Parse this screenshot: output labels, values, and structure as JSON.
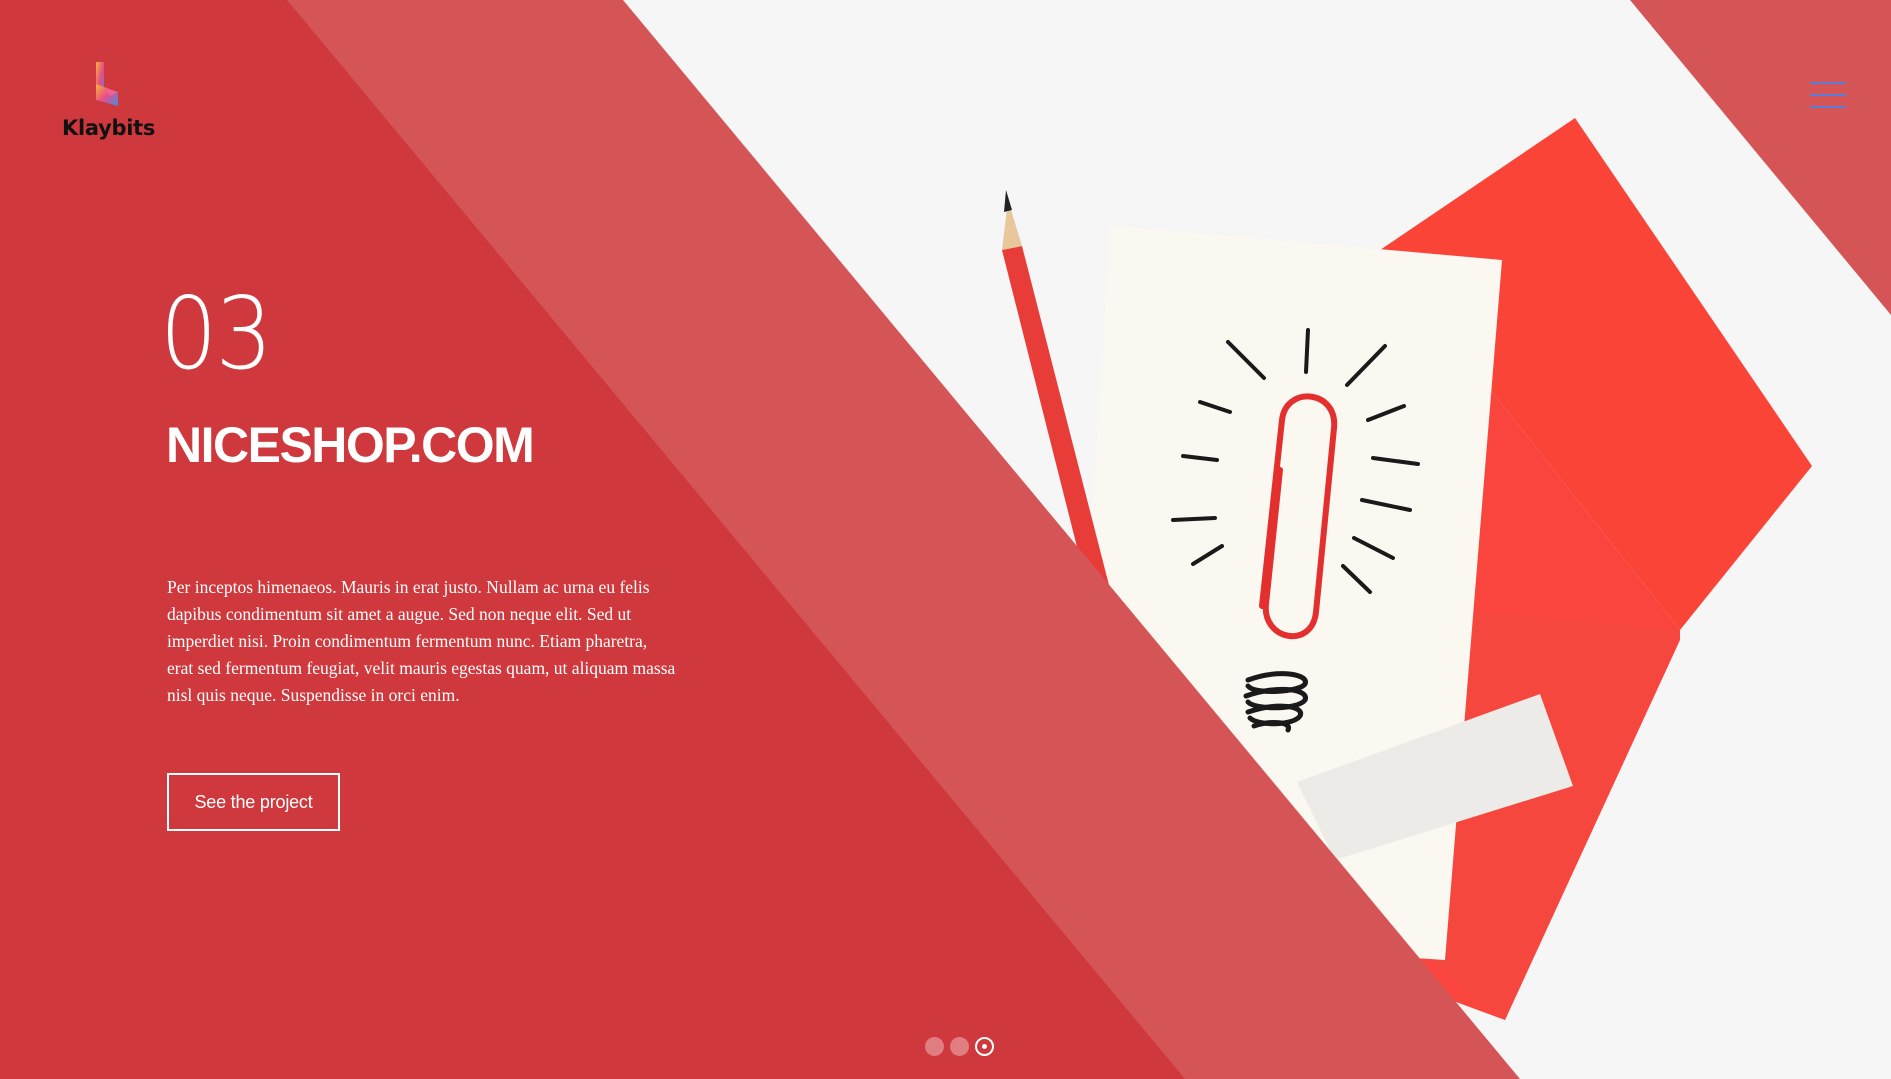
{
  "brand": {
    "name": "Klaybits",
    "logo_icon": "klaybits-logo-mark"
  },
  "header": {
    "menu_icon": "hamburger-menu-icon"
  },
  "slide": {
    "number": "03",
    "title": "NICESHOP.COM",
    "description": "Per inceptos himenaeos. Mauris in erat justo. Nullam ac urna eu felis dapibus condimentum sit amet a augue. Sed non neque elit. Sed ut imperdiet nisi. Proin condimentum fermentum nunc. Etiam pharetra, erat sed fermentum feugiat, velit mauris egestas quam, ut aliquam massa nisl quis neque. Suspendisse in orci enim.",
    "button_label": "See the project"
  },
  "pagination": {
    "total": 3,
    "active_index": 2
  },
  "colors": {
    "primary_red": "#cf383c",
    "overlay_red": "#d55557",
    "paper_red": "#f9453d",
    "menu_blue": "#5b7ed6",
    "white": "#ffffff"
  },
  "hero_image": {
    "subject": "lightbulb-sketch-with-paperclip-pencil-and-sticky-notes"
  }
}
